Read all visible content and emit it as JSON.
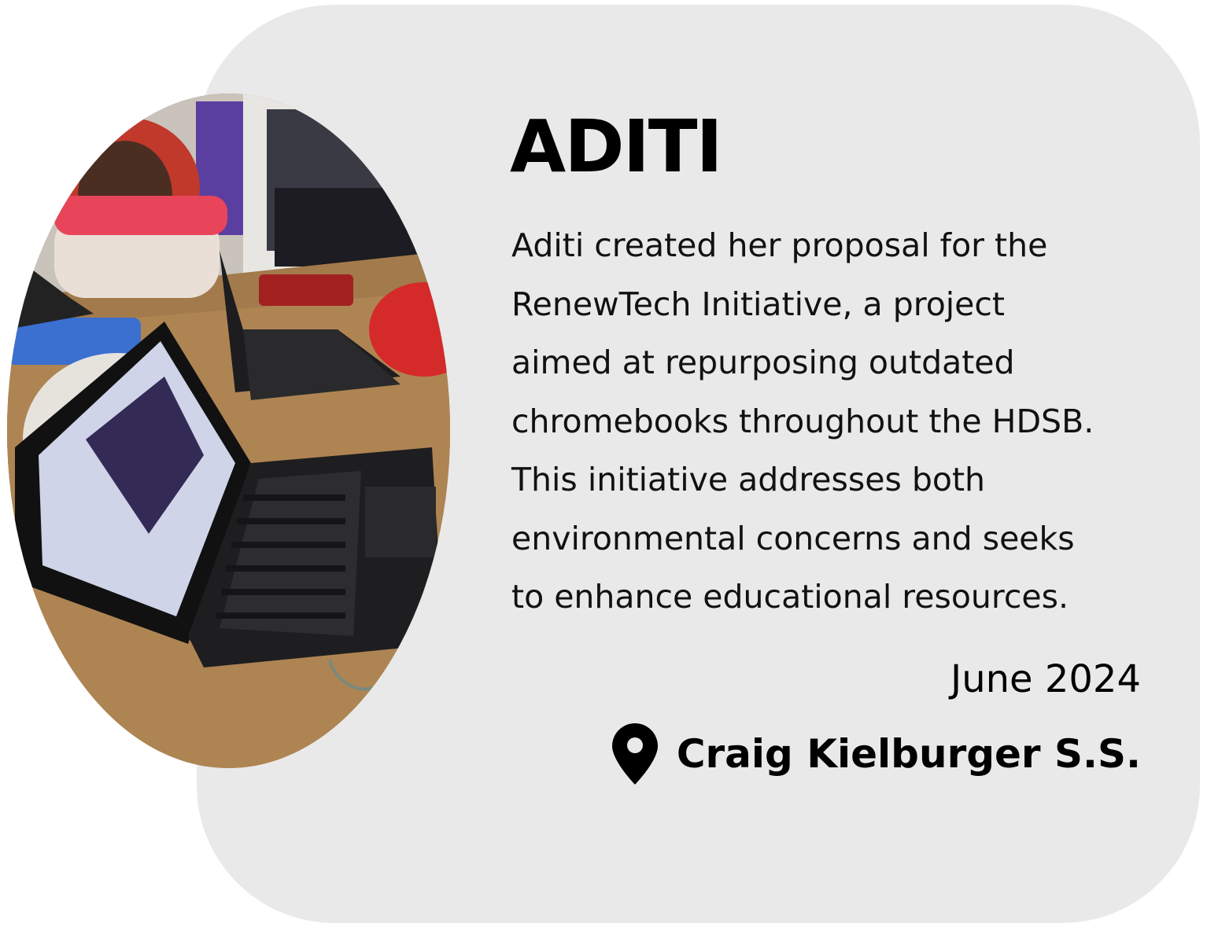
{
  "profile": {
    "name": "ADITI",
    "description_lines": [
      "Aditi created her proposal for the",
      "RenewTech Initiative, a project",
      "aimed at repurposing outdated",
      "chromebooks throughout the HDSB.",
      "This initiative addresses both",
      "environmental concerns and seeks",
      "to enhance educational resources."
    ],
    "date": "June 2024",
    "school": "Craig Kielburger S.S.",
    "location_icon": "map-pin-icon"
  },
  "colors": {
    "card_background": "#e9e9e9",
    "text": "#000000"
  }
}
